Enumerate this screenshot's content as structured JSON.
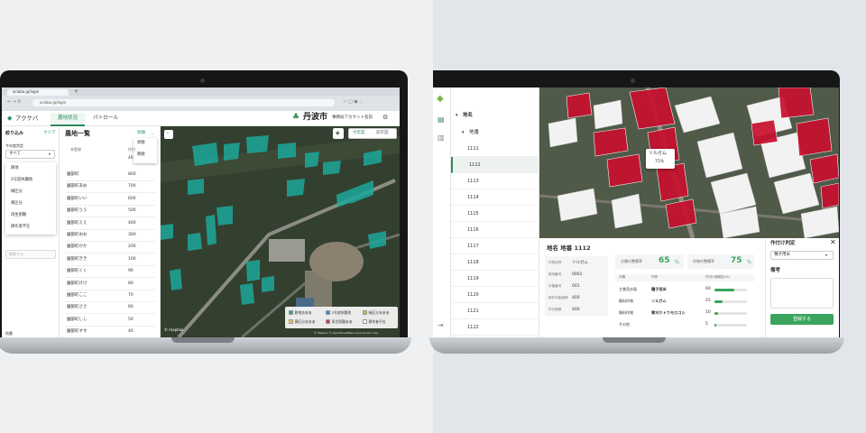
{
  "left": {
    "browser": {
      "tab_title": "aclaba.jp/login",
      "url": "aclaba.jp/login"
    },
    "app": {
      "logo": "アクケバ",
      "nav": [
        {
          "label": "農地状況"
        },
        {
          "label": "パトロール"
        }
      ],
      "city": "丹波市",
      "account": "事務局アカウント名前"
    },
    "filter": {
      "title": "絞り込み",
      "clear": "クリア",
      "year_label": "今年度判定",
      "select_value": "すべて",
      "options": [
        "耕地",
        "2号遊休農地",
        "緑区分",
        "黄区分",
        "再生困難",
        "耕作者不在"
      ],
      "chiban_label": "地番",
      "chiban_placeholder": "検索する"
    },
    "farmlist": {
      "title": "農地一覧",
      "sort": "昇順",
      "sort_options": [
        "昇順",
        "降順"
      ],
      "col1": "未登録",
      "col2": "作付",
      "first_value": "40",
      "rows": [
        {
          "name": "園部町",
          "v": "800"
        },
        {
          "name": "園部町あお",
          "v": "700"
        },
        {
          "name": "園部町いい",
          "v": "600"
        },
        {
          "name": "園部町うう",
          "v": "500"
        },
        {
          "name": "園部町ええ",
          "v": "400"
        },
        {
          "name": "園部町おお",
          "v": "300"
        },
        {
          "name": "園部町かか",
          "v": "200"
        },
        {
          "name": "園部町きき",
          "v": "100"
        },
        {
          "name": "園部町くく",
          "v": "90"
        },
        {
          "name": "園部町けけ",
          "v": "80"
        },
        {
          "name": "園部町ここ",
          "v": "70"
        },
        {
          "name": "園部町ささ",
          "v": "60"
        },
        {
          "name": "園部町しし",
          "v": "50"
        },
        {
          "name": "園部町すす",
          "v": "40"
        }
      ]
    },
    "map": {
      "toggle": [
        "今年度",
        "前年度"
      ],
      "legend": [
        {
          "label": "耕地あああ",
          "color": "#1ca89a"
        },
        {
          "label": "2号遊休農地",
          "color": "#2a8ad8"
        },
        {
          "label": "緑区分あああ",
          "color": "#9acd45"
        },
        {
          "label": "黄区分あああ",
          "color": "#e8c632"
        },
        {
          "label": "再生困難ああ",
          "color": "#d6324c"
        },
        {
          "label": "耕作者不在",
          "color": "#ffffff"
        }
      ],
      "attribution": "© mapbox",
      "credit": "© Mapbox © OpenStreetMap Improve this map"
    }
  },
  "right": {
    "tree": {
      "root": "地名",
      "sub": "地番",
      "items": [
        "1111",
        "1112",
        "1113",
        "1114",
        "1115",
        "1116",
        "1117",
        "1118",
        "1119",
        "1120",
        "1121",
        "1122"
      ],
      "selected": "1112"
    },
    "popup": {
      "crop": "ソルガム",
      "pct": "75%"
    },
    "detail": {
      "title": "地名 地番 1112",
      "fields": [
        {
          "label": "作物名称",
          "value": "ソルガム"
        },
        {
          "label": "耕地番号",
          "value": "0001"
        },
        {
          "label": "分筆番号",
          "value": "001"
        },
        {
          "label": "耕作可能面積",
          "value": "400"
        },
        {
          "label": "作付面積",
          "value": "400"
        }
      ],
      "rate1": {
        "label": "分類の整備率",
        "value": "65",
        "unit": "%"
      },
      "rate2": {
        "label": "作物の整備率",
        "value": "75",
        "unit": "%"
      },
      "table_head": [
        "分類",
        "作物",
        "作付け面積比(%)"
      ],
      "table": [
        {
          "cat": "主食用水稲",
          "crop": "種子用米",
          "pct": 60
        },
        {
          "cat": "飼料作物",
          "crop": "ソルガム",
          "pct": 25
        },
        {
          "cat": "飼料作物",
          "crop": "青刈りトウモロコシ",
          "pct": 10
        },
        {
          "cat": "その他",
          "crop": "",
          "pct": 5
        }
      ]
    },
    "judge": {
      "title": "作付け判定",
      "select": "種子用米",
      "note": "備考",
      "submit": "登録する"
    }
  }
}
